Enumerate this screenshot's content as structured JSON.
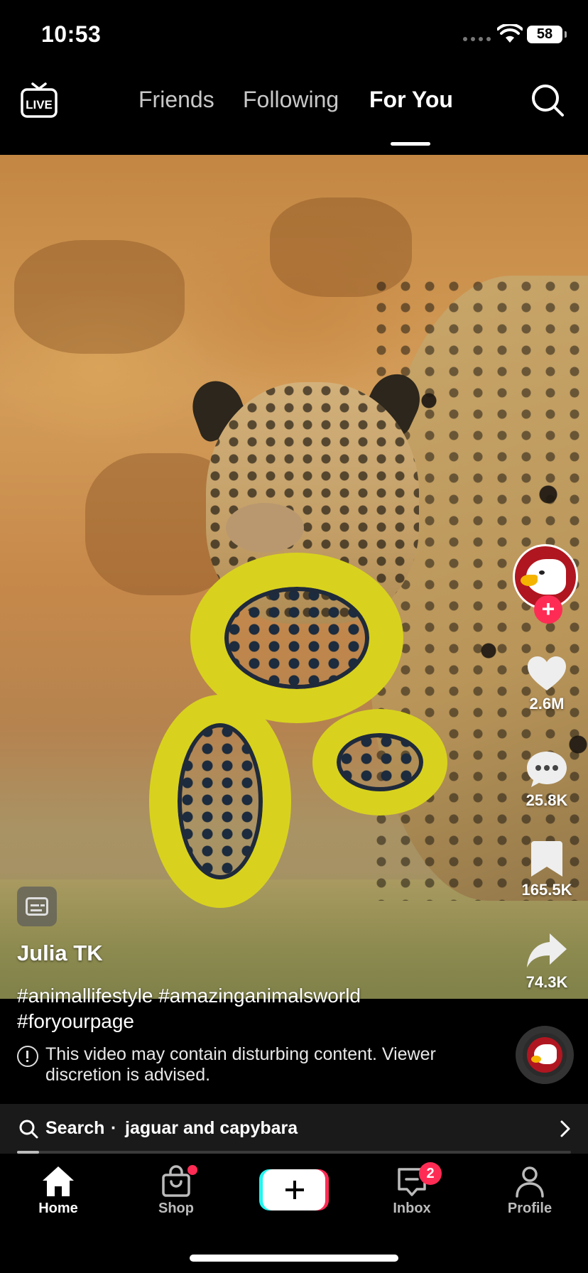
{
  "status_bar": {
    "time": "10:53",
    "battery": "58"
  },
  "top_nav": {
    "live_label": "LIVE",
    "tabs": [
      {
        "label": "Friends",
        "active": false
      },
      {
        "label": "Following",
        "active": false
      },
      {
        "label": "For You",
        "active": true
      }
    ]
  },
  "video": {
    "author": "Julia TK",
    "hashtags": "#animallifestyle #amazinganimalsworld #foryourpage",
    "warning": "This video may contain disturbing content. Viewer discretion is advised.",
    "progress_percent": 4
  },
  "actions": {
    "likes": "2.6M",
    "comments": "25.8K",
    "saves": "165.5K",
    "shares": "74.3K",
    "follow_symbol": "+"
  },
  "search_bar": {
    "label": "Search",
    "separator": "·",
    "query": "jaguar and capybara"
  },
  "bottom_nav": {
    "items": [
      {
        "label": "Home",
        "icon": "home-icon",
        "active": true
      },
      {
        "label": "Shop",
        "icon": "shopping-bag-icon",
        "active": false
      },
      {
        "label": "Inbox",
        "icon": "inbox-icon",
        "active": false,
        "badge": "2"
      },
      {
        "label": "Profile",
        "icon": "profile-icon",
        "active": false
      }
    ]
  },
  "colors": {
    "accent_pink": "#fe2c55",
    "accent_cyan": "#25f4ee",
    "background": "#000000"
  }
}
